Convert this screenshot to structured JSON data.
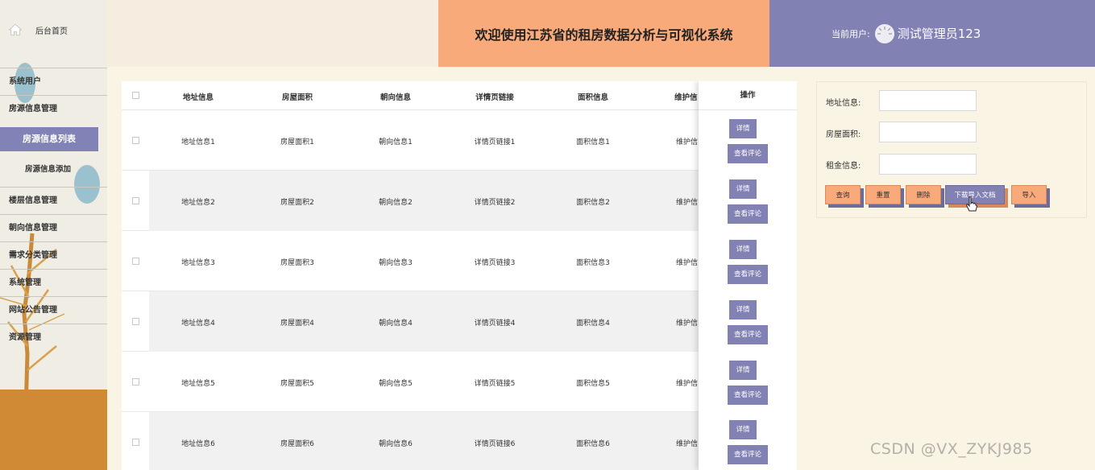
{
  "sidebar": {
    "home_label": "后台首页",
    "menu": [
      {
        "label": "系统用户"
      },
      {
        "label": "房源信息管理"
      },
      {
        "label": "楼层信息管理"
      },
      {
        "label": "朝向信息管理"
      },
      {
        "label": "需求分类管理"
      },
      {
        "label": "系统管理"
      },
      {
        "label": "网站公告管理"
      },
      {
        "label": "资源管理"
      }
    ],
    "active_sub": "房源信息列表",
    "sub_item": "房源信息添加"
  },
  "header": {
    "title": "欢迎使用江苏省的租房数据分析与可视化系统",
    "user_label": "当前用户:",
    "user_name": "测试管理员123"
  },
  "table": {
    "columns": [
      "地址信息",
      "房屋面积",
      "朝向信息",
      "详情页链接",
      "面积信息",
      "维护信"
    ],
    "ops_header": "操作",
    "detail_btn": "详情",
    "comment_btn": "查看评论",
    "rows": [
      [
        "地址信息1",
        "房屋面积1",
        "朝向信息1",
        "详情页链接1",
        "面积信息1",
        "维护信"
      ],
      [
        "地址信息2",
        "房屋面积2",
        "朝向信息2",
        "详情页链接2",
        "面积信息2",
        "维护信"
      ],
      [
        "地址信息3",
        "房屋面积3",
        "朝向信息3",
        "详情页链接3",
        "面积信息3",
        "维护信"
      ],
      [
        "地址信息4",
        "房屋面积4",
        "朝向信息4",
        "详情页链接4",
        "面积信息4",
        "维护信"
      ],
      [
        "地址信息5",
        "房屋面积5",
        "朝向信息5",
        "详情页链接5",
        "面积信息5",
        "维护信"
      ],
      [
        "地址信息6",
        "房屋面积6",
        "朝向信息6",
        "详情页链接6",
        "面积信息6",
        "维护信"
      ]
    ]
  },
  "search": {
    "address_label": "地址信息:",
    "area_label": "房屋面积:",
    "rent_label": "租金信息:",
    "address_value": "",
    "area_value": "",
    "rent_value": "",
    "buttons": {
      "query": "查询",
      "reset": "重置",
      "delete": "删除",
      "download_template": "下载导入文档",
      "import": "导入"
    }
  },
  "watermark": "CSDN @VX_ZYKJ985",
  "colors": {
    "accent_purple": "#8281b4",
    "accent_orange": "#f9aa7a",
    "background": "#faf4e4"
  }
}
